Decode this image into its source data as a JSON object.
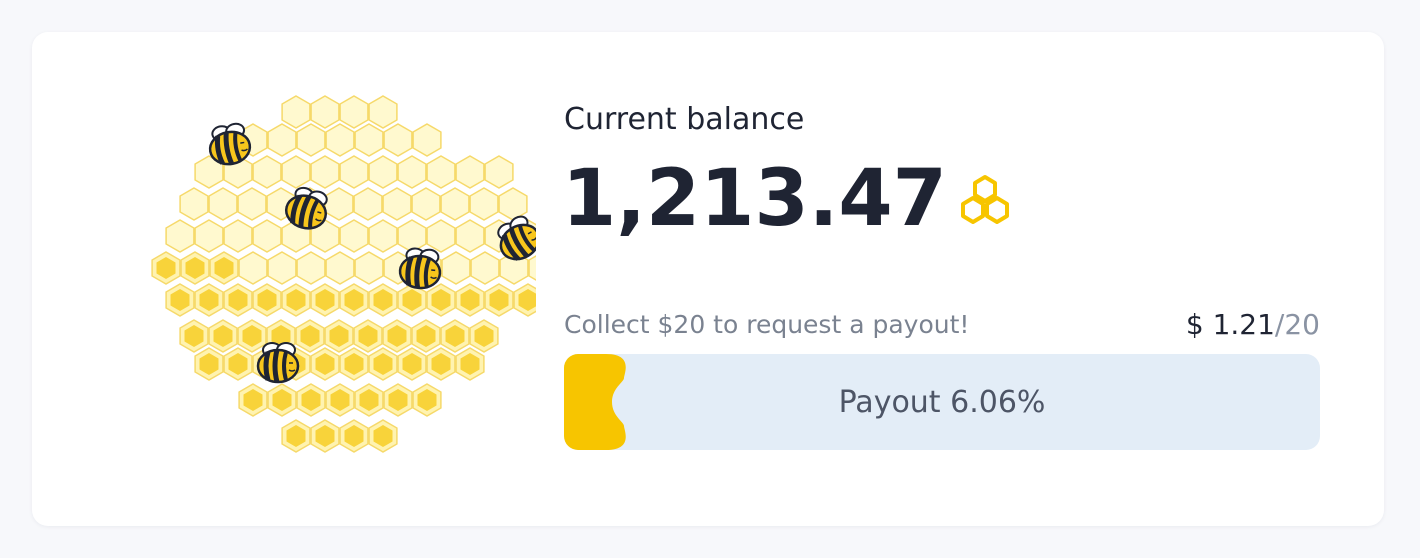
{
  "balance": {
    "label": "Current balance",
    "value": "1,213.47",
    "currency_icon": "honeycomb-icon"
  },
  "payout": {
    "hint": "Collect $20 to request a payout!",
    "currency_symbol": "$",
    "current": "1.21",
    "separator": "/",
    "target": "20",
    "progress_label": "Payout 6.06%",
    "progress_fraction": 0.0606
  },
  "illustration": {
    "name": "beehive-illustration",
    "bee_icon": "bee-icon"
  },
  "colors": {
    "accent": "#f7c500",
    "honey": "#f8d33a",
    "comb_light": "#fff9cf",
    "track": "#e3edf7",
    "text_dark": "#1f2433",
    "text_muted": "#7a8290"
  }
}
